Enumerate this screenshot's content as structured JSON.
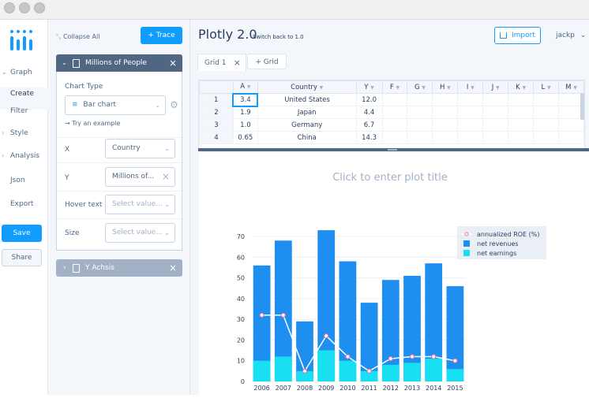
{
  "nav": {
    "graph": "Graph",
    "create": "Create",
    "filter": "Filter",
    "style": "Style",
    "analysis": "Analysis",
    "json": "Json",
    "export": "Export",
    "save": "Save",
    "share": "Share"
  },
  "panel": {
    "collapse_all": "Collapse All",
    "trace_btn": "+ Trace",
    "trace_title": "Millions of People",
    "chart_type_label": "Chart Type",
    "chart_type_value": "Bar chart",
    "try_example": "Try an example",
    "x_label": "X",
    "x_value": "Country",
    "y_label": "Y",
    "y_value": "Millions of...",
    "hover_label": "Hover text",
    "hover_placeholder": "Select value...",
    "size_label": "Size",
    "size_placeholder": "Select value...",
    "fold2_title": "Y Achsis"
  },
  "header": {
    "title": "Plotly 2.0",
    "switch_back": "Switch back to 1.0",
    "import_btn": "Import",
    "user": "jackp"
  },
  "tabs": {
    "grid1": "Grid 1",
    "add_grid": "+ Grid"
  },
  "grid": {
    "columns": [
      "A",
      "Country",
      "Y",
      "F",
      "G",
      "H",
      "I",
      "J",
      "K",
      "L",
      "M"
    ],
    "rows": [
      {
        "n": "1",
        "a": "3.4",
        "country": "United States",
        "y": "12.0"
      },
      {
        "n": "2",
        "a": "1.9",
        "country": "Japan",
        "y": "4.4"
      },
      {
        "n": "3",
        "a": "1.0",
        "country": "Germany",
        "y": "6.7"
      },
      {
        "n": "4",
        "a": "0.65",
        "country": "China",
        "y": "14.3"
      }
    ]
  },
  "plot": {
    "title_placeholder": "Click to enter plot title"
  },
  "colors": {
    "accent": "#119dff",
    "revenue_bar": "#1f8ef1",
    "earnings_bar": "#19e0f0",
    "roe_line": "#ffffff",
    "roe_marker": "#e07aa4"
  },
  "chart_data": {
    "type": "bar",
    "categories": [
      "2006",
      "2007",
      "2008",
      "2009",
      "2010",
      "2011",
      "2012",
      "2013",
      "2014",
      "2015"
    ],
    "series": [
      {
        "name": "annualized ROE (%)",
        "kind": "line",
        "values": [
          32,
          32,
          5,
          22,
          12,
          5,
          11,
          12,
          12,
          10
        ]
      },
      {
        "name": "net revenues",
        "kind": "bar",
        "values": [
          56,
          68,
          29,
          73,
          58,
          38,
          49,
          51,
          57,
          46
        ]
      },
      {
        "name": "net earnings",
        "kind": "bar",
        "values": [
          10,
          12,
          5,
          15,
          10,
          5,
          8,
          9,
          11,
          6
        ]
      }
    ],
    "yticks": [
      "0",
      "10",
      "20",
      "30",
      "40",
      "50",
      "60",
      "70"
    ],
    "ylim": [
      0,
      70
    ],
    "legend": "top-right",
    "barmode": "overlay"
  }
}
